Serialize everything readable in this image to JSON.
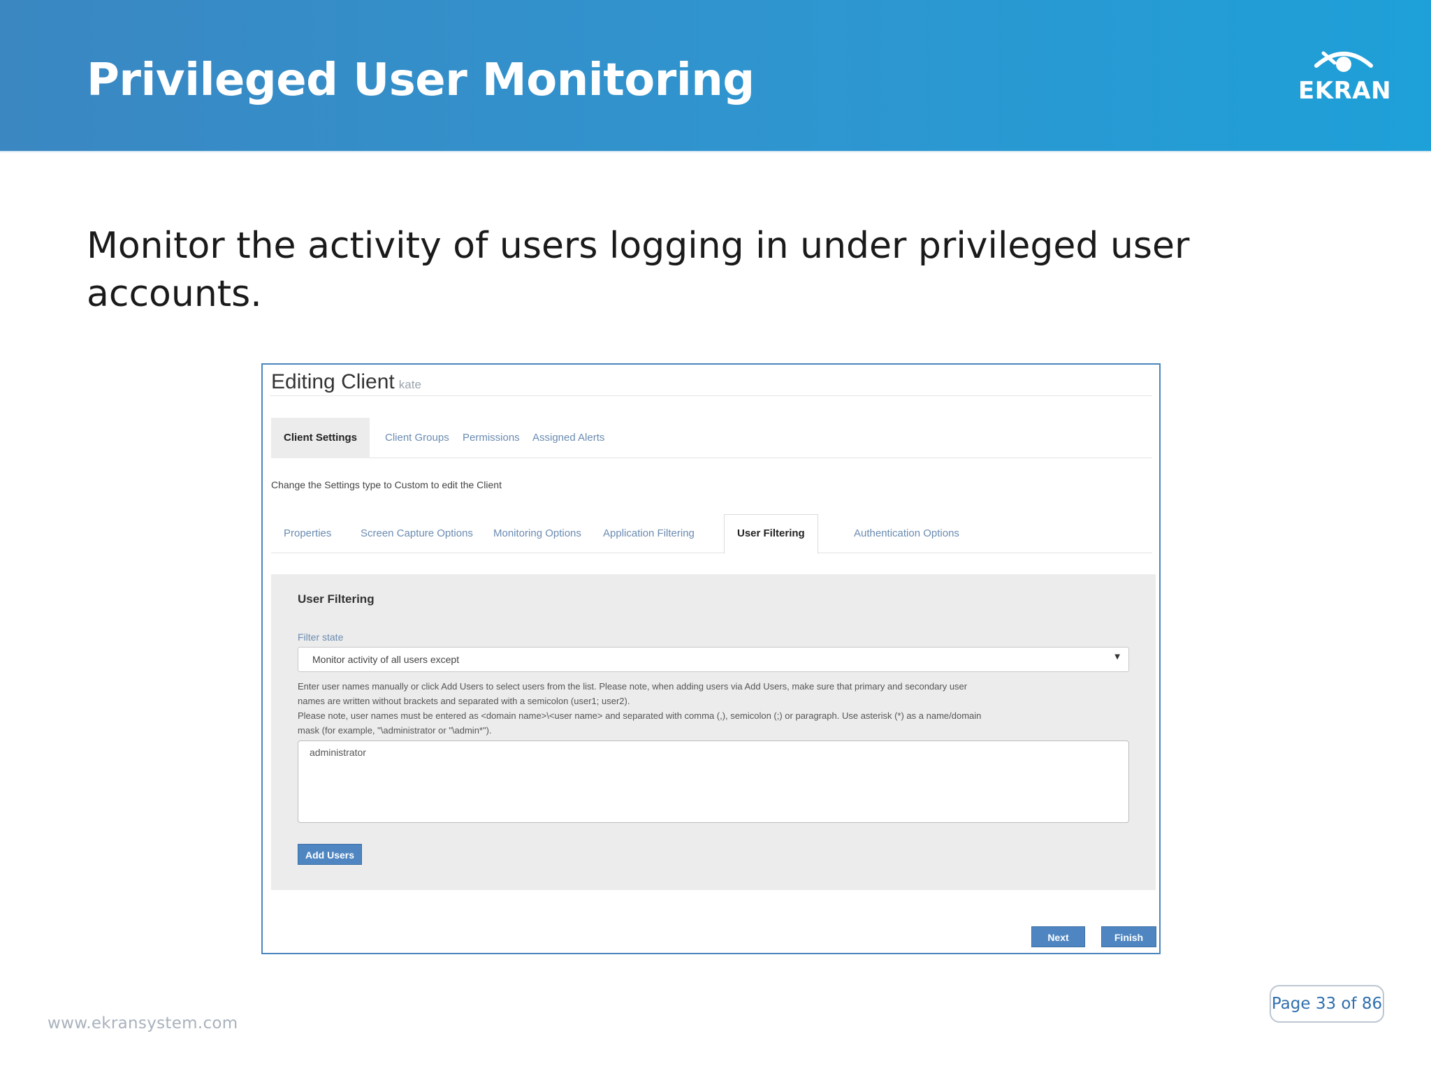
{
  "slide": {
    "title": "Privileged User Monitoring",
    "subtitle": "Monitor the activity of users logging in under privileged user accounts.",
    "logo_text": "EKRAN",
    "footer_url": "www.ekransystem.com",
    "page_label": "Page 33 of 86"
  },
  "window": {
    "title": "Editing Client",
    "client_name": "kate",
    "tabs": [
      {
        "label": "Client Settings",
        "active": true
      },
      {
        "label": "Client Groups",
        "active": false
      },
      {
        "label": "Permissions",
        "active": false
      },
      {
        "label": "Assigned Alerts",
        "active": false
      }
    ],
    "hint": "Change the Settings type to Custom to edit the Client",
    "subtabs": [
      {
        "label": "Properties",
        "active": false
      },
      {
        "label": "Screen Capture Options",
        "active": false
      },
      {
        "label": "Monitoring Options",
        "active": false
      },
      {
        "label": "Application Filtering",
        "active": false
      },
      {
        "label": "User Filtering",
        "active": true
      },
      {
        "label": "Authentication Options",
        "active": false
      }
    ],
    "panel": {
      "title": "User Filtering",
      "filter_label": "Filter state",
      "filter_value": "Monitor activity of all users except",
      "help_lines": [
        "Enter user names manually or click Add Users to select users from the list. Please note, when adding users via Add Users, make sure that primary and secondary user",
        "names are written without brackets and separated with a semicolon (user1; user2).",
        "Please note, user names must be entered as <domain name>\\<user name> and separated with comma (,), semicolon (;) or paragraph. Use asterisk (*) as a name/domain",
        "mask (for example, \"\\administrator or \"\\admin*\")."
      ],
      "textarea_value": "administrator",
      "add_users_label": "Add Users"
    },
    "next_label": "Next",
    "finish_label": "Finish"
  }
}
